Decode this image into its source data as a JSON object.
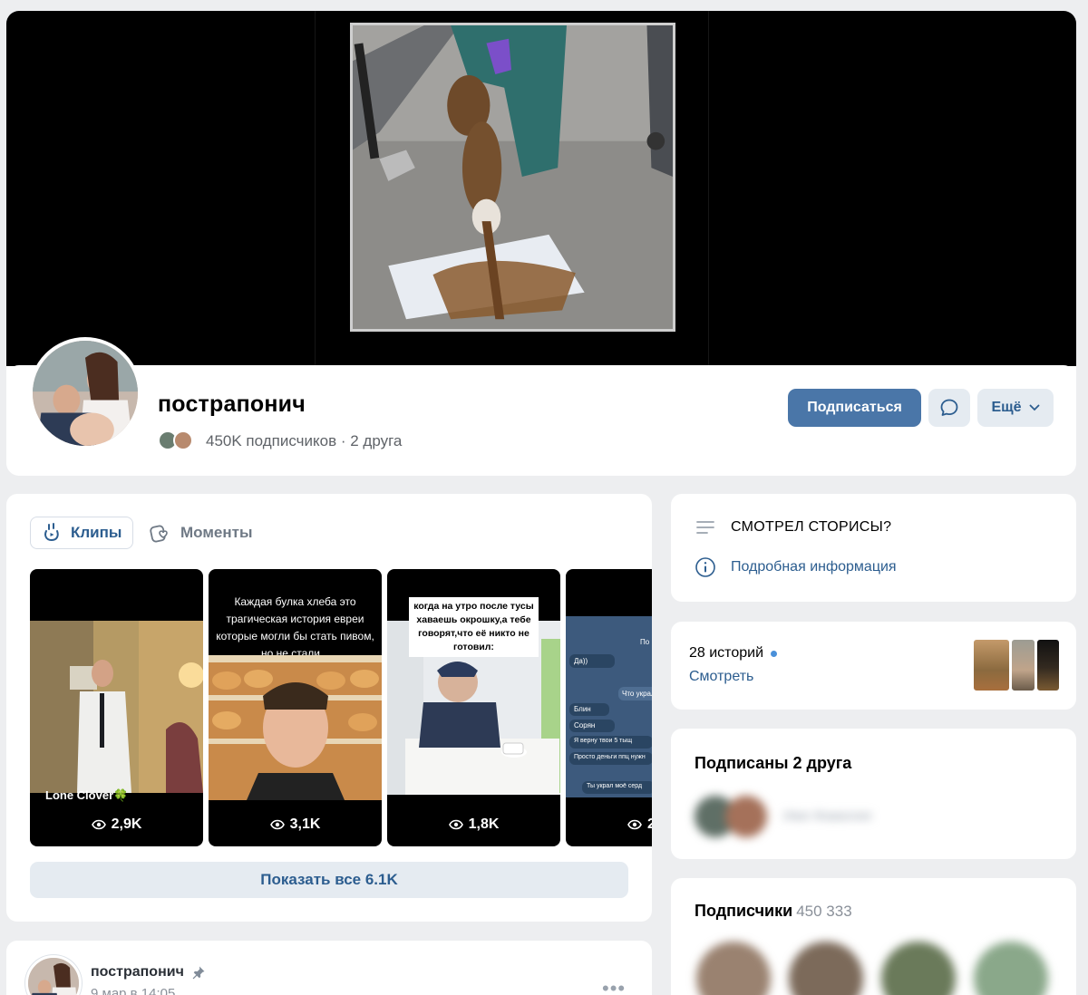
{
  "profile": {
    "name": "пострапонич",
    "meta": "450K подписчиков · 2 друга"
  },
  "actions": {
    "subscribe_label": "Подписаться",
    "more_label": "Ещё"
  },
  "tabs": {
    "clips_label": "Клипы",
    "moments_label": "Моменты"
  },
  "clips": [
    {
      "views": "2,9K",
      "author": "Lone Clover🍀",
      "caption": ""
    },
    {
      "views": "3,1K",
      "caption": "Каждая булка хлеба это трагическая история евреи которые могли бы стать пивом, но не стали..."
    },
    {
      "views": "1,8K",
      "caption": "когда на утро после тусы хаваешь окрошку,а тебе говорят,что её никто не готовил:"
    },
    {
      "views": "2"
    }
  ],
  "chat_preview": {
    "m1": "Да))",
    "m2": "Что украл",
    "m3": "Блин",
    "m4": "Сорян",
    "m5": "Я верну твои 5 тыщ",
    "m6": "Просто деньги ппц нужн",
    "m7": "Ты украл моё серд",
    "m8": "По"
  },
  "show_all_label": "Показать все 6.1K",
  "post": {
    "author": "пострапонич",
    "date": "9 мар в 14:05",
    "menu": "•••"
  },
  "info": {
    "title": "СМОТРЕЛ СТОРИСЫ?",
    "details_link": "Подробная информация"
  },
  "stories": {
    "count": "28 историй",
    "watch_label": "Смотреть"
  },
  "friends": {
    "title": "Подписаны 2 друга",
    "names_blurred": "Имя Фамилия"
  },
  "followers": {
    "title": "Подписчики",
    "count": "450 333"
  },
  "colors": {
    "accent": "#4a76a8",
    "link": "#2c5d8f",
    "page_bg": "#edeef0",
    "button_secondary_bg": "#e5ebf1"
  }
}
